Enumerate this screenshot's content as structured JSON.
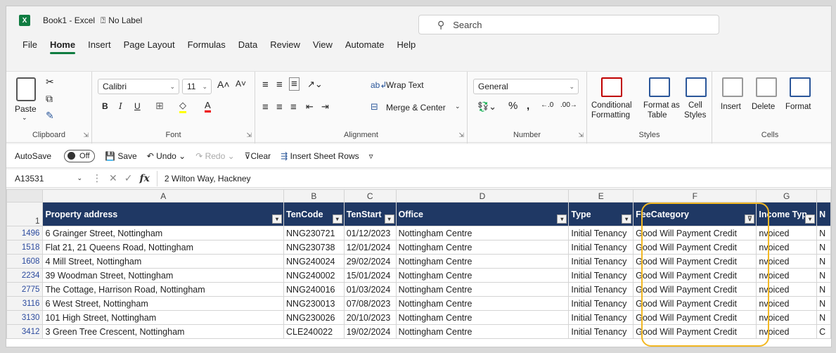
{
  "window": {
    "title": "Book1 - Excel",
    "sensitivity_label": "No Label"
  },
  "search": {
    "placeholder": "Search"
  },
  "menu": [
    "File",
    "Home",
    "Insert",
    "Page Layout",
    "Formulas",
    "Data",
    "Review",
    "View",
    "Automate",
    "Help"
  ],
  "menu_active": "Home",
  "ribbon": {
    "clipboard": {
      "paste": "Paste",
      "label": "Clipboard"
    },
    "font": {
      "name": "Calibri",
      "size": "11",
      "label": "Font"
    },
    "alignment": {
      "wrap_text": "Wrap Text",
      "merge_center": "Merge & Center",
      "label": "Alignment"
    },
    "number": {
      "format": "General",
      "label": "Number"
    },
    "styles": {
      "conditional": "Conditional",
      "formatting": "Formatting",
      "format_as": "Format as",
      "table": "Table",
      "cell": "Cell",
      "styles_word": "Styles",
      "label": "Styles"
    },
    "cells": {
      "insert": "Insert",
      "delete": "Delete",
      "format": "Format",
      "label": "Cells"
    }
  },
  "qat": {
    "autosave": "AutoSave",
    "autosave_state": "Off",
    "save": "Save",
    "undo": "Undo",
    "redo": "Redo",
    "clear": "Clear",
    "insert_rows": "Insert Sheet Rows"
  },
  "formula_bar": {
    "name_box": "A13531",
    "content": "2 Wilton Way, Hackney"
  },
  "columns": [
    "A",
    "B",
    "C",
    "D",
    "E",
    "F",
    "G"
  ],
  "header_row_number": "1",
  "headers": [
    "Property address",
    "TenCode",
    "TenStart",
    "Office",
    "Type",
    "FeeCategory",
    "Income Typ",
    "N"
  ],
  "rows": [
    {
      "num": "1496",
      "cells": [
        "6 Grainger Street, Nottingham",
        "NNG230721",
        "01/12/2023",
        "Nottingham Centre",
        "Initial Tenancy",
        "Good Will Payment Credit",
        "nvoiced",
        "N"
      ]
    },
    {
      "num": "1518",
      "cells": [
        "Flat 21, 21 Queens Road, Nottingham",
        "NNG230738",
        "12/01/2024",
        "Nottingham Centre",
        "Initial Tenancy",
        "Good Will Payment Credit",
        "nvoiced",
        "N"
      ]
    },
    {
      "num": "1608",
      "cells": [
        "4 Mill Street, Nottingham",
        "NNG240024",
        "29/02/2024",
        "Nottingham Centre",
        "Initial Tenancy",
        "Good Will Payment Credit",
        "nvoiced",
        "N"
      ]
    },
    {
      "num": "2234",
      "cells": [
        "39 Woodman Street, Nottingham",
        "NNG240002",
        "15/01/2024",
        "Nottingham Centre",
        "Initial Tenancy",
        "Good Will Payment Credit",
        "nvoiced",
        "N"
      ]
    },
    {
      "num": "2775",
      "cells": [
        "The Cottage, Harrison Road, Nottingham",
        "NNG240016",
        "01/03/2024",
        "Nottingham Centre",
        "Initial Tenancy",
        "Good Will Payment Credit",
        "nvoiced",
        "N"
      ]
    },
    {
      "num": "3116",
      "cells": [
        "6 West Street, Nottingham",
        "NNG230013",
        "07/08/2023",
        "Nottingham Centre",
        "Initial Tenancy",
        "Good Will Payment Credit",
        "nvoiced",
        "N"
      ]
    },
    {
      "num": "3130",
      "cells": [
        "101 High Street, Nottingham",
        "NNG230026",
        "20/10/2023",
        "Nottingham Centre",
        "Initial Tenancy",
        "Good Will Payment Credit",
        "nvoiced",
        "N"
      ]
    },
    {
      "num": "3412",
      "cells": [
        "3 Green Tree Crescent, Nottingham",
        "CLE240022",
        "19/02/2024",
        "Nottingham Centre",
        "Initial Tenancy",
        "Good Will Payment Credit",
        "nvoiced",
        "C"
      ]
    }
  ],
  "colors": {
    "header_fill": "#1f3864",
    "accent": "#107c41",
    "highlight": "#f2b824",
    "row_number": "#2b4a9e"
  }
}
